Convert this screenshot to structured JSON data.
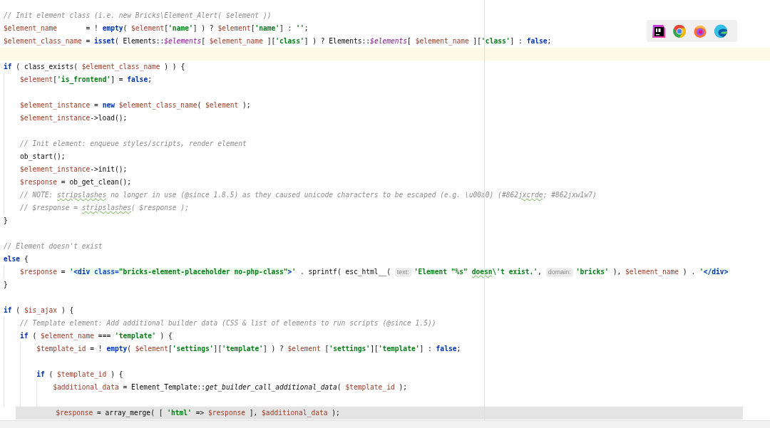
{
  "editor": {
    "lines": [
      {
        "kind": "code",
        "selected": false,
        "tokens": [
          {
            "kind": "comment",
            "text": "// Init element class (i.e. new Bricks\\Element_Alert( $element ))"
          }
        ]
      },
      {
        "kind": "code",
        "selected": false,
        "tokens": [
          {
            "kind": "var",
            "text": "$element_name"
          },
          {
            "kind": "plain",
            "text": "       = ! "
          },
          {
            "kind": "keyword",
            "text": "empty"
          },
          {
            "kind": "plain",
            "text": "( "
          },
          {
            "kind": "var",
            "text": "$element"
          },
          {
            "kind": "plain",
            "text": "["
          },
          {
            "kind": "string",
            "text": "'name'"
          },
          {
            "kind": "plain",
            "text": "] ) ? "
          },
          {
            "kind": "var",
            "text": "$element"
          },
          {
            "kind": "plain",
            "text": "["
          },
          {
            "kind": "string",
            "text": "'name'"
          },
          {
            "kind": "plain",
            "text": "] : "
          },
          {
            "kind": "string",
            "text": "''"
          },
          {
            "kind": "plain",
            "text": ";"
          }
        ]
      },
      {
        "kind": "code",
        "selected": false,
        "tokens": [
          {
            "kind": "var",
            "text": "$element_class_name"
          },
          {
            "kind": "plain",
            "text": " = "
          },
          {
            "kind": "keyword",
            "text": "isset"
          },
          {
            "kind": "plain",
            "text": "( Elements::"
          },
          {
            "kind": "field",
            "text": "$elements"
          },
          {
            "kind": "plain",
            "text": "[ "
          },
          {
            "kind": "var",
            "text": "$element_name"
          },
          {
            "kind": "plain",
            "text": " ]["
          },
          {
            "kind": "string",
            "text": "'class'"
          },
          {
            "kind": "plain",
            "text": "] ) ? Elements::"
          },
          {
            "kind": "field",
            "text": "$elements"
          },
          {
            "kind": "plain",
            "text": "[ "
          },
          {
            "kind": "var",
            "text": "$element_name"
          },
          {
            "kind": "plain",
            "text": " ]["
          },
          {
            "kind": "string",
            "text": "'class'"
          },
          {
            "kind": "plain",
            "text": "] : "
          },
          {
            "kind": "keyword",
            "text": "false"
          },
          {
            "kind": "plain",
            "text": ";"
          }
        ]
      },
      {
        "kind": "caret",
        "selected": false
      },
      {
        "kind": "code",
        "selected": false,
        "tokens": [
          {
            "kind": "keyword",
            "text": "if"
          },
          {
            "kind": "plain",
            "text": " ( class_exists( "
          },
          {
            "kind": "var",
            "text": "$element_class_name"
          },
          {
            "kind": "plain",
            "text": " ) ) {"
          }
        ],
        "children": [
          {
            "kind": "code",
            "selected": false,
            "tokens": [
              {
                "kind": "var",
                "text": "$element"
              },
              {
                "kind": "plain",
                "text": "["
              },
              {
                "kind": "string",
                "text": "'is_frontend'"
              },
              {
                "kind": "plain",
                "text": "] = "
              },
              {
                "kind": "keyword",
                "text": "false"
              },
              {
                "kind": "plain",
                "text": ";"
              }
            ]
          },
          {
            "kind": "blank",
            "selected": false
          },
          {
            "kind": "code",
            "selected": false,
            "tokens": [
              {
                "kind": "var",
                "text": "$element_instance"
              },
              {
                "kind": "plain",
                "text": " = "
              },
              {
                "kind": "keyword",
                "text": "new"
              },
              {
                "kind": "var",
                "text": " $element_class_name"
              },
              {
                "kind": "plain",
                "text": "( "
              },
              {
                "kind": "var",
                "text": "$element"
              },
              {
                "kind": "plain",
                "text": " );"
              }
            ]
          },
          {
            "kind": "code",
            "selected": false,
            "tokens": [
              {
                "kind": "var",
                "text": "$element_instance"
              },
              {
                "kind": "plain",
                "text": "->load();"
              }
            ]
          },
          {
            "kind": "blank",
            "selected": false
          },
          {
            "kind": "code",
            "selected": false,
            "tokens": [
              {
                "kind": "comment",
                "text": "// Init element: enqueue styles/scripts, render element"
              }
            ]
          },
          {
            "kind": "code",
            "selected": false,
            "tokens": [
              {
                "kind": "plain",
                "text": "ob_start();"
              }
            ]
          },
          {
            "kind": "code",
            "selected": false,
            "tokens": [
              {
                "kind": "var",
                "text": "$element_instance"
              },
              {
                "kind": "plain",
                "text": "->init();"
              }
            ]
          },
          {
            "kind": "code",
            "selected": false,
            "tokens": [
              {
                "kind": "var",
                "text": "$response"
              },
              {
                "kind": "plain",
                "text": " = ob_get_clean();"
              }
            ]
          },
          {
            "kind": "code",
            "selected": false,
            "tokens": [
              {
                "kind": "comment",
                "text": "// NOTE: "
              },
              {
                "kind": "comment",
                "text": "stripslashes",
                "typo": true
              },
              {
                "kind": "comment",
                "text": " no longer in use (@since 1.8.5) as they caused unicode characters to be escaped (e.g. \\u00a0) (#862"
              },
              {
                "kind": "comment",
                "text": "jxcrde",
                "typo": true
              },
              {
                "kind": "comment",
                "text": "; #862jxw1w7)"
              }
            ]
          },
          {
            "kind": "code",
            "selected": false,
            "tokens": [
              {
                "kind": "comment",
                "text": "// $response = "
              },
              {
                "kind": "comment",
                "text": "stripslashes",
                "typo": true
              },
              {
                "kind": "comment",
                "text": "( $response );"
              }
            ]
          }
        ]
      },
      {
        "kind": "code",
        "selected": false,
        "tokens": [
          {
            "kind": "plain",
            "text": "}"
          }
        ]
      },
      {
        "kind": "blank",
        "selected": false
      },
      {
        "kind": "code",
        "selected": false,
        "tokens": [
          {
            "kind": "comment",
            "text": "// Element doesn't exist"
          }
        ]
      },
      {
        "kind": "code",
        "selected": false,
        "tokens": [
          {
            "kind": "keyword",
            "text": "else"
          },
          {
            "kind": "plain",
            "text": " {"
          }
        ],
        "children": [
          {
            "kind": "code",
            "selected": false,
            "tokens": [
              {
                "kind": "var",
                "text": "$response"
              },
              {
                "kind": "plain",
                "text": " = "
              },
              {
                "kind": "string",
                "text": "'"
              },
              {
                "kind": "html-tag",
                "text": "<div "
              },
              {
                "kind": "html-attr",
                "text": "class="
              },
              {
                "kind": "html-value",
                "text": "\"bricks-element-placeholder no-php-class\""
              },
              {
                "kind": "html-tag",
                "text": ">"
              },
              {
                "kind": "string",
                "text": "'"
              },
              {
                "kind": "plain",
                "text": " . sprintf( esc_html__( "
              },
              {
                "kind": "hint",
                "text": "text:"
              },
              {
                "kind": "string",
                "text": "'Element \"%s\" "
              },
              {
                "kind": "string",
                "text": "doesn",
                "typo": true
              },
              {
                "kind": "string",
                "text": "\\'t exist.'"
              },
              {
                "kind": "plain",
                "text": ", "
              },
              {
                "kind": "hint",
                "text": "domain:"
              },
              {
                "kind": "string",
                "text": "'bricks'"
              },
              {
                "kind": "plain",
                "text": " ), "
              },
              {
                "kind": "var",
                "text": "$element_name"
              },
              {
                "kind": "plain",
                "text": " ) . "
              },
              {
                "kind": "string",
                "text": "'"
              },
              {
                "kind": "html-tag",
                "text": "</div>"
              }
            ]
          }
        ]
      },
      {
        "kind": "code",
        "selected": false,
        "tokens": [
          {
            "kind": "plain",
            "text": "}"
          }
        ]
      },
      {
        "kind": "blank",
        "selected": false
      },
      {
        "kind": "code",
        "selected": false,
        "tokens": [
          {
            "kind": "keyword",
            "text": "if"
          },
          {
            "kind": "plain",
            "text": " ( "
          },
          {
            "kind": "var",
            "text": "$is_ajax"
          },
          {
            "kind": "plain",
            "text": " ) {"
          }
        ],
        "children": [
          {
            "kind": "code",
            "selected": false,
            "tokens": [
              {
                "kind": "comment",
                "text": "// Template element: Add additional builder data (CSS & list of elements to run scripts (@since 1.5))"
              }
            ]
          },
          {
            "kind": "code",
            "selected": false,
            "tokens": [
              {
                "kind": "keyword",
                "text": "if"
              },
              {
                "kind": "plain",
                "text": " ( "
              },
              {
                "kind": "var",
                "text": "$element_name"
              },
              {
                "kind": "plain",
                "text": " === "
              },
              {
                "kind": "string",
                "text": "'template'"
              },
              {
                "kind": "plain",
                "text": " ) {"
              }
            ],
            "children": [
              {
                "kind": "code",
                "selected": false,
                "tokens": [
                  {
                    "kind": "var",
                    "text": "$template_id"
                  },
                  {
                    "kind": "plain",
                    "text": " = ! "
                  },
                  {
                    "kind": "keyword",
                    "text": "empty"
                  },
                  {
                    "kind": "plain",
                    "text": "( "
                  },
                  {
                    "kind": "var",
                    "text": "$element"
                  },
                  {
                    "kind": "plain",
                    "text": "["
                  },
                  {
                    "kind": "string",
                    "text": "'settings'"
                  },
                  {
                    "kind": "plain",
                    "text": "]["
                  },
                  {
                    "kind": "string",
                    "text": "'template'"
                  },
                  {
                    "kind": "plain",
                    "text": "] ) ? "
                  },
                  {
                    "kind": "var",
                    "text": "$element"
                  },
                  {
                    "kind": "plain",
                    "text": " ["
                  },
                  {
                    "kind": "string",
                    "text": "'settings'"
                  },
                  {
                    "kind": "plain",
                    "text": "]["
                  },
                  {
                    "kind": "string",
                    "text": "'template'"
                  },
                  {
                    "kind": "plain",
                    "text": "] : "
                  },
                  {
                    "kind": "keyword",
                    "text": "false"
                  },
                  {
                    "kind": "plain",
                    "text": ";"
                  }
                ]
              },
              {
                "kind": "blank",
                "selected": false
              },
              {
                "kind": "code",
                "selected": false,
                "tokens": [
                  {
                    "kind": "keyword",
                    "text": "if"
                  },
                  {
                    "kind": "plain",
                    "text": " ( "
                  },
                  {
                    "kind": "var",
                    "text": "$template_id"
                  },
                  {
                    "kind": "plain",
                    "text": " ) {"
                  }
                ],
                "children": [
                  {
                    "kind": "code",
                    "selected": false,
                    "tokens": [
                      {
                        "kind": "var",
                        "text": "$additional_data"
                      },
                      {
                        "kind": "plain",
                        "text": " = Element_Template::"
                      },
                      {
                        "kind": "method",
                        "text": "get_builder_call_additional_data"
                      },
                      {
                        "kind": "plain",
                        "text": "( "
                      },
                      {
                        "kind": "var",
                        "text": "$template_id"
                      },
                      {
                        "kind": "plain",
                        "text": " );"
                      }
                    ]
                  },
                  {
                    "kind": "blank",
                    "selected": false
                  },
                  {
                    "kind": "code",
                    "selected": true,
                    "tokens": [
                      {
                        "kind": "var",
                        "text": "$response"
                      },
                      {
                        "kind": "plain",
                        "text": " = array_merge( [ "
                      },
                      {
                        "kind": "string",
                        "text": "'html'"
                      },
                      {
                        "kind": "plain",
                        "text": " => "
                      },
                      {
                        "kind": "var",
                        "text": "$response"
                      },
                      {
                        "kind": "plain",
                        "text": " ], "
                      },
                      {
                        "kind": "var",
                        "text": "$additional_data"
                      },
                      {
                        "kind": "plain",
                        "text": " );"
                      }
                    ]
                  }
                ]
              }
            ]
          }
        ]
      }
    ]
  },
  "browser_popup": {
    "icons": [
      {
        "kind": "ide"
      },
      {
        "kind": "chrome"
      },
      {
        "kind": "firefox"
      },
      {
        "kind": "edge"
      }
    ]
  }
}
